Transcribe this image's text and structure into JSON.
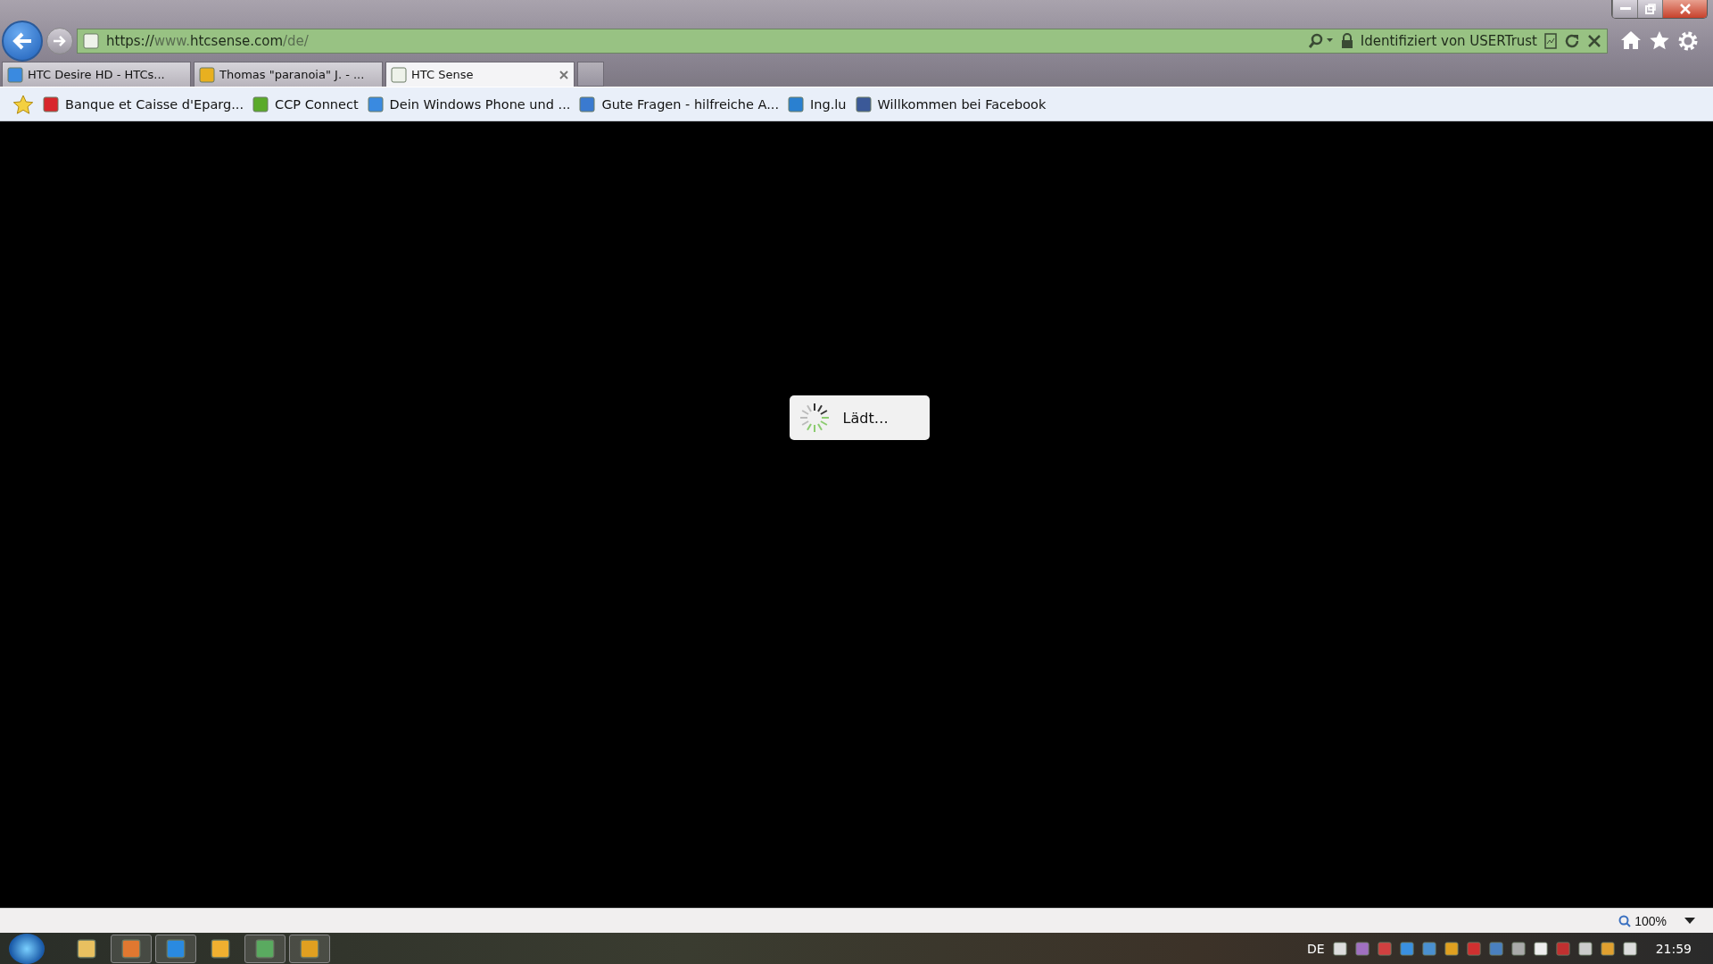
{
  "address_bar": {
    "url_parts": [
      {
        "text": "https://",
        "emphasis": true
      },
      {
        "text": "www.",
        "emphasis": false
      },
      {
        "text": "htcsense.com",
        "emphasis": true
      },
      {
        "text": "/de/",
        "emphasis": false
      }
    ],
    "security": "Identifiziert von USERTrust"
  },
  "tabs": [
    {
      "label": "HTC Desire HD - HTCs...",
      "selected": false
    },
    {
      "label": "Thomas \"paranoia\" J. - ...",
      "selected": false
    },
    {
      "label": "HTC Sense",
      "selected": true
    }
  ],
  "favorites": [
    "Banque et Caisse d'Eparg...",
    "CCP Connect",
    "Dein Windows Phone und ...",
    "Gute Fragen - hilfreiche A...",
    "Ing.lu",
    "Willkommen bei Facebook"
  ],
  "loading": {
    "label": "Lädt…"
  },
  "status_bar": {
    "zoom": "100%"
  },
  "taskbar": {
    "language": "DE",
    "clock": "21:59"
  }
}
